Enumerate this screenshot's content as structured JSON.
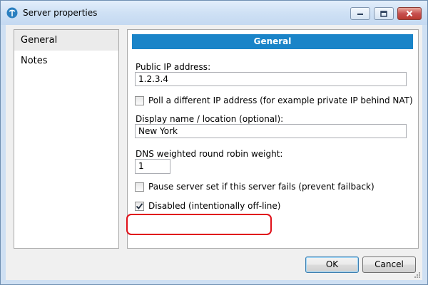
{
  "window": {
    "title": "Server properties",
    "icon": "app-icon"
  },
  "sidebar": {
    "items": [
      {
        "label": "General",
        "selected": true
      },
      {
        "label": "Notes",
        "selected": false
      }
    ]
  },
  "panel": {
    "header": "General",
    "public_ip": {
      "label": "Public IP address:",
      "value": "1.2.3.4"
    },
    "poll_different": {
      "label": "Poll a different IP address (for example private IP behind NAT)",
      "checked": false
    },
    "display_name": {
      "label": "Display name / location (optional):",
      "value": "New York"
    },
    "dns_weight": {
      "label": "DNS weighted round robin weight:",
      "value": "1"
    },
    "pause_server": {
      "label": "Pause server set if this server fails (prevent failback)",
      "checked": false
    },
    "disabled": {
      "label": "Disabled (intentionally off-line)",
      "checked": true,
      "highlight_color": "#e01019"
    }
  },
  "buttons": {
    "ok": "OK",
    "cancel": "Cancel"
  },
  "colors": {
    "header_bg": "#1a84c8",
    "header_text": "#ffffff"
  }
}
